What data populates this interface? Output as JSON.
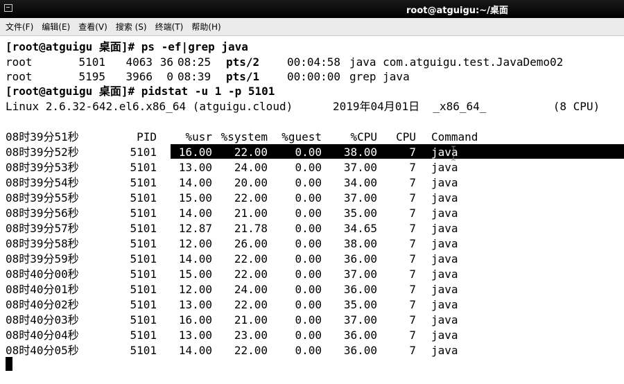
{
  "window": {
    "title": "root@atguigu:~/桌面"
  },
  "menu": [
    "文件(F)",
    "编辑(E)",
    "查看(V)",
    "搜索 (S)",
    "终端(T)",
    "帮助(H)"
  ],
  "terminal": {
    "prompt1": "[root@atguigu 桌面]# ps -ef|grep java",
    "ps_rows": [
      {
        "user": "root",
        "pid": "5101",
        "ppid": "4063",
        "c": "36",
        "stime": "08:25",
        "tty": "pts/2",
        "time": "00:04:58",
        "cmd": "java com.atguigu.test.JavaDemo02"
      },
      {
        "user": "root",
        "pid": "5195",
        "ppid": "3966",
        "c": "0",
        "stime": "08:39",
        "tty": "pts/1",
        "time": "00:00:00",
        "cmd": "grep java"
      }
    ],
    "prompt2": "[root@atguigu 桌面]# pidstat -u 1 -p 5101",
    "sysinfo": "Linux 2.6.32-642.el6.x86_64 (atguigu.cloud)      2019年04月01日  _x86_64_          (8 CPU)",
    "headers": {
      "time": "08时39分51秒",
      "pid": "PID",
      "usr": "%usr",
      "system": "%system",
      "guest": "%guest",
      "cpu_pct": "%CPU",
      "cpu": "CPU",
      "command": "Command"
    },
    "rows": [
      {
        "time": "08时39分52秒",
        "pid": "5101",
        "usr": "16.00",
        "system": "22.00",
        "guest": "0.00",
        "cpu_pct": "38.00",
        "cpu": "7",
        "command": "java"
      },
      {
        "time": "08时39分53秒",
        "pid": "5101",
        "usr": "13.00",
        "system": "24.00",
        "guest": "0.00",
        "cpu_pct": "37.00",
        "cpu": "7",
        "command": "java"
      },
      {
        "time": "08时39分54秒",
        "pid": "5101",
        "usr": "14.00",
        "system": "20.00",
        "guest": "0.00",
        "cpu_pct": "34.00",
        "cpu": "7",
        "command": "java"
      },
      {
        "time": "08时39分55秒",
        "pid": "5101",
        "usr": "15.00",
        "system": "22.00",
        "guest": "0.00",
        "cpu_pct": "37.00",
        "cpu": "7",
        "command": "java"
      },
      {
        "time": "08时39分56秒",
        "pid": "5101",
        "usr": "14.00",
        "system": "21.00",
        "guest": "0.00",
        "cpu_pct": "35.00",
        "cpu": "7",
        "command": "java"
      },
      {
        "time": "08时39分57秒",
        "pid": "5101",
        "usr": "12.87",
        "system": "21.78",
        "guest": "0.00",
        "cpu_pct": "34.65",
        "cpu": "7",
        "command": "java"
      },
      {
        "time": "08时39分58秒",
        "pid": "5101",
        "usr": "12.00",
        "system": "26.00",
        "guest": "0.00",
        "cpu_pct": "38.00",
        "cpu": "7",
        "command": "java"
      },
      {
        "time": "08时39分59秒",
        "pid": "5101",
        "usr": "14.00",
        "system": "22.00",
        "guest": "0.00",
        "cpu_pct": "36.00",
        "cpu": "7",
        "command": "java"
      },
      {
        "time": "08时40分00秒",
        "pid": "5101",
        "usr": "15.00",
        "system": "22.00",
        "guest": "0.00",
        "cpu_pct": "37.00",
        "cpu": "7",
        "command": "java"
      },
      {
        "time": "08时40分01秒",
        "pid": "5101",
        "usr": "12.00",
        "system": "24.00",
        "guest": "0.00",
        "cpu_pct": "36.00",
        "cpu": "7",
        "command": "java"
      },
      {
        "time": "08时40分02秒",
        "pid": "5101",
        "usr": "13.00",
        "system": "22.00",
        "guest": "0.00",
        "cpu_pct": "35.00",
        "cpu": "7",
        "command": "java"
      },
      {
        "time": "08时40分03秒",
        "pid": "5101",
        "usr": "16.00",
        "system": "21.00",
        "guest": "0.00",
        "cpu_pct": "37.00",
        "cpu": "7",
        "command": "java"
      },
      {
        "time": "08时40分04秒",
        "pid": "5101",
        "usr": "13.00",
        "system": "23.00",
        "guest": "0.00",
        "cpu_pct": "36.00",
        "cpu": "7",
        "command": "java"
      },
      {
        "time": "08时40分05秒",
        "pid": "5101",
        "usr": "14.00",
        "system": "22.00",
        "guest": "0.00",
        "cpu_pct": "36.00",
        "cpu": "7",
        "command": "java"
      }
    ]
  }
}
